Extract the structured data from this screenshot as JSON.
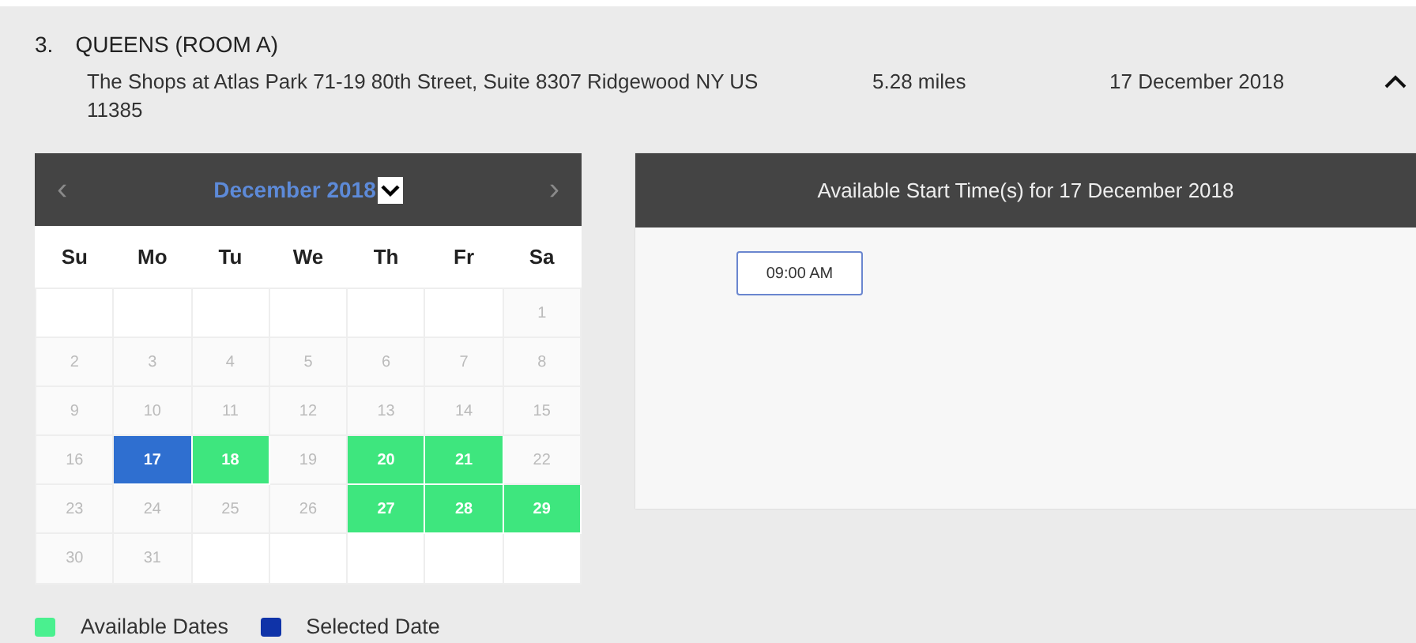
{
  "location": {
    "number": "3.",
    "name": "QUEENS (ROOM A)",
    "address": "The Shops at Atlas Park 71-19 80th Street, Suite 8307 Ridgewood NY US 11385",
    "distance": "5.28 miles",
    "date": "17 December 2018",
    "expanded": true
  },
  "calendar": {
    "prev": "‹",
    "next": "›",
    "nav_disabled": true,
    "month": "December 2018",
    "weekdays": [
      "Su",
      "Mo",
      "Tu",
      "We",
      "Th",
      "Fr",
      "Sa"
    ],
    "weeks": [
      [
        {
          "kind": "blank"
        },
        {
          "kind": "blank"
        },
        {
          "kind": "blank"
        },
        {
          "kind": "blank"
        },
        {
          "kind": "blank"
        },
        {
          "kind": "blank"
        },
        {
          "kind": "day",
          "day": "1",
          "available": false,
          "selected": false
        }
      ],
      [
        {
          "kind": "day",
          "day": "2",
          "available": false,
          "selected": false
        },
        {
          "kind": "day",
          "day": "3",
          "available": false,
          "selected": false
        },
        {
          "kind": "day",
          "day": "4",
          "available": false,
          "selected": false
        },
        {
          "kind": "day",
          "day": "5",
          "available": false,
          "selected": false
        },
        {
          "kind": "day",
          "day": "6",
          "available": false,
          "selected": false
        },
        {
          "kind": "day",
          "day": "7",
          "available": false,
          "selected": false
        },
        {
          "kind": "day",
          "day": "8",
          "available": false,
          "selected": false
        }
      ],
      [
        {
          "kind": "day",
          "day": "9",
          "available": false,
          "selected": false
        },
        {
          "kind": "day",
          "day": "10",
          "available": false,
          "selected": false
        },
        {
          "kind": "day",
          "day": "11",
          "available": false,
          "selected": false
        },
        {
          "kind": "day",
          "day": "12",
          "available": false,
          "selected": false
        },
        {
          "kind": "day",
          "day": "13",
          "available": false,
          "selected": false
        },
        {
          "kind": "day",
          "day": "14",
          "available": false,
          "selected": false
        },
        {
          "kind": "day",
          "day": "15",
          "available": false,
          "selected": false
        }
      ],
      [
        {
          "kind": "day",
          "day": "16",
          "available": false,
          "selected": false
        },
        {
          "kind": "day",
          "day": "17",
          "available": true,
          "selected": true
        },
        {
          "kind": "day",
          "day": "18",
          "available": true,
          "selected": false
        },
        {
          "kind": "day",
          "day": "19",
          "available": false,
          "selected": false
        },
        {
          "kind": "day",
          "day": "20",
          "available": true,
          "selected": false
        },
        {
          "kind": "day",
          "day": "21",
          "available": true,
          "selected": false
        },
        {
          "kind": "day",
          "day": "22",
          "available": false,
          "selected": false
        }
      ],
      [
        {
          "kind": "day",
          "day": "23",
          "available": false,
          "selected": false
        },
        {
          "kind": "day",
          "day": "24",
          "available": false,
          "selected": false
        },
        {
          "kind": "day",
          "day": "25",
          "available": false,
          "selected": false
        },
        {
          "kind": "day",
          "day": "26",
          "available": false,
          "selected": false
        },
        {
          "kind": "day",
          "day": "27",
          "available": true,
          "selected": false
        },
        {
          "kind": "day",
          "day": "28",
          "available": true,
          "selected": false
        },
        {
          "kind": "day",
          "day": "29",
          "available": true,
          "selected": false
        }
      ],
      [
        {
          "kind": "day",
          "day": "30",
          "available": false,
          "selected": false
        },
        {
          "kind": "day",
          "day": "31",
          "available": false,
          "selected": false
        },
        {
          "kind": "blank"
        },
        {
          "kind": "blank"
        },
        {
          "kind": "blank"
        },
        {
          "kind": "blank"
        },
        {
          "kind": "blank"
        }
      ]
    ]
  },
  "times": {
    "title": "Available Start Time(s) for 17 December 2018",
    "slots": [
      {
        "label": "09:00 AM"
      }
    ]
  },
  "legend": [
    {
      "label": "Available Dates",
      "color": "#4af08f"
    },
    {
      "label": "Selected Date",
      "color": "#0f33a8"
    }
  ]
}
